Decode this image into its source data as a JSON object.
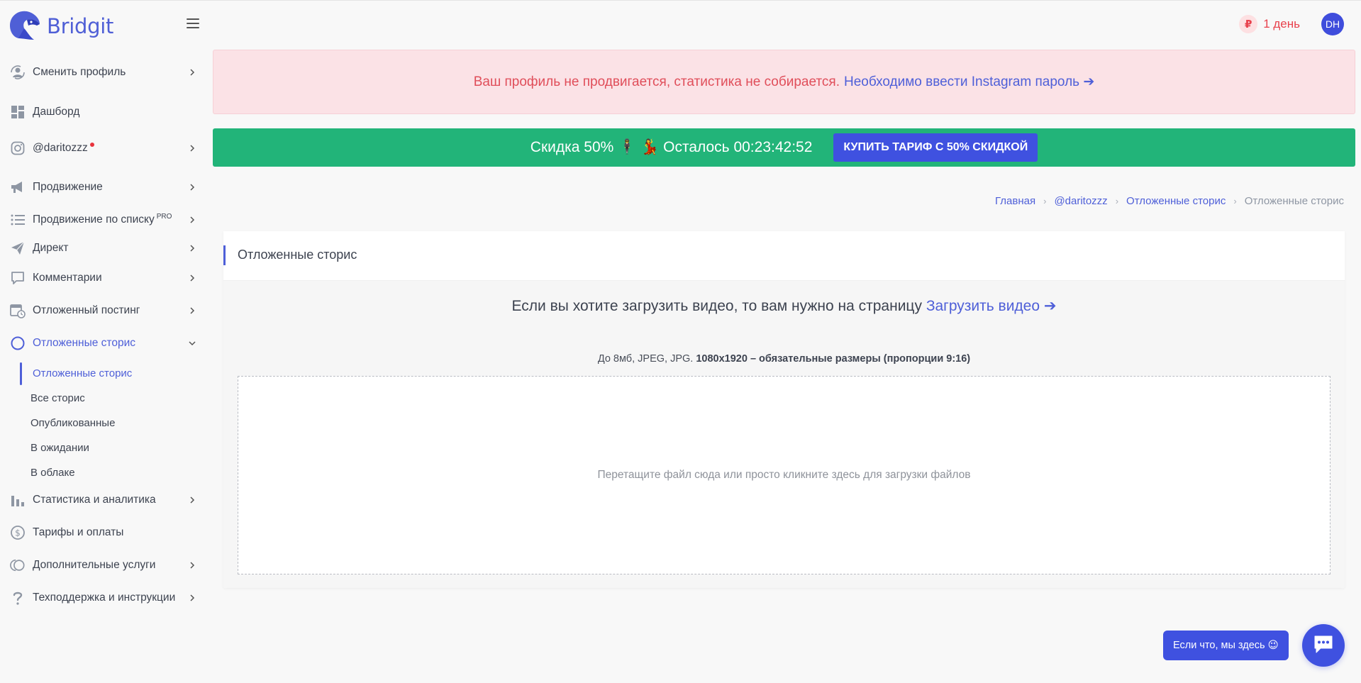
{
  "app": {
    "logo_text": "Bridgit"
  },
  "header": {
    "currency_symbol": "₽",
    "days_left": "1 день",
    "avatar_initials": "DH"
  },
  "sidebar": {
    "items": [
      {
        "label": "Сменить профиль",
        "icon": "switch-profile-icon"
      },
      {
        "label": "Дашборд",
        "icon": "dashboard-icon"
      },
      {
        "label": "@daritozzz",
        "icon": "instagram-icon"
      },
      {
        "label": "Продвижение",
        "icon": "megaphone-icon"
      },
      {
        "label": "Продвижение по списку",
        "badge": "PRO",
        "icon": "list-icon"
      },
      {
        "label": "Директ",
        "icon": "paper-plane-icon"
      },
      {
        "label": "Комментарии",
        "icon": "comment-icon"
      },
      {
        "label": "Отложенный постинг",
        "icon": "calendar-clock-icon"
      },
      {
        "label": "Отложенные сторис",
        "icon": "circle-icon"
      },
      {
        "label": "Статистика и аналитика",
        "icon": "bar-chart-icon"
      },
      {
        "label": "Тарифы и оплаты",
        "icon": "dollar-circle-icon"
      },
      {
        "label": "Дополнительные услуги",
        "icon": "services-icon"
      },
      {
        "label": "Техподдержка и инструкции",
        "icon": "question-icon"
      }
    ],
    "stories_sub": [
      {
        "label": "Отложенные сторис"
      },
      {
        "label": "Все сторис"
      },
      {
        "label": "Опубликованные"
      },
      {
        "label": "В ожидании"
      },
      {
        "label": "В облаке"
      }
    ]
  },
  "alert": {
    "text": "Ваш профиль не продвигается, статистика не собирается.",
    "link": "Необходимо ввести Instagram пароль ➔"
  },
  "promo": {
    "text": "Скидка 50% 🕴 💃 Осталось 00:23:42:52",
    "button": "КУПИТЬ ТАРИФ С 50% СКИДКОЙ"
  },
  "breadcrumb": {
    "items": [
      "Главная",
      "@daritozzz",
      "Отложенные сторис",
      "Отложенные сторис"
    ]
  },
  "card": {
    "title": "Отложенные сторис",
    "hint_text": "Если вы хотите загрузить видео, то вам нужно на страницу",
    "hint_link": "Загрузить видео ➔",
    "req_plain": "До 8мб, JPEG, JPG.",
    "req_bold": "1080x1920 – обязательные размеры (пропорции 9:16)",
    "dropzone_text": "Перетащите файл сюда или просто кликните здесь для загрузки файлов"
  },
  "chat": {
    "bubble_text": "Если что, мы здесь 😉"
  },
  "colors": {
    "accent": "#4e5fd8",
    "promo_green": "#22b479",
    "alert_bg": "#fbe2e6",
    "alert_text": "#e04e5a"
  }
}
